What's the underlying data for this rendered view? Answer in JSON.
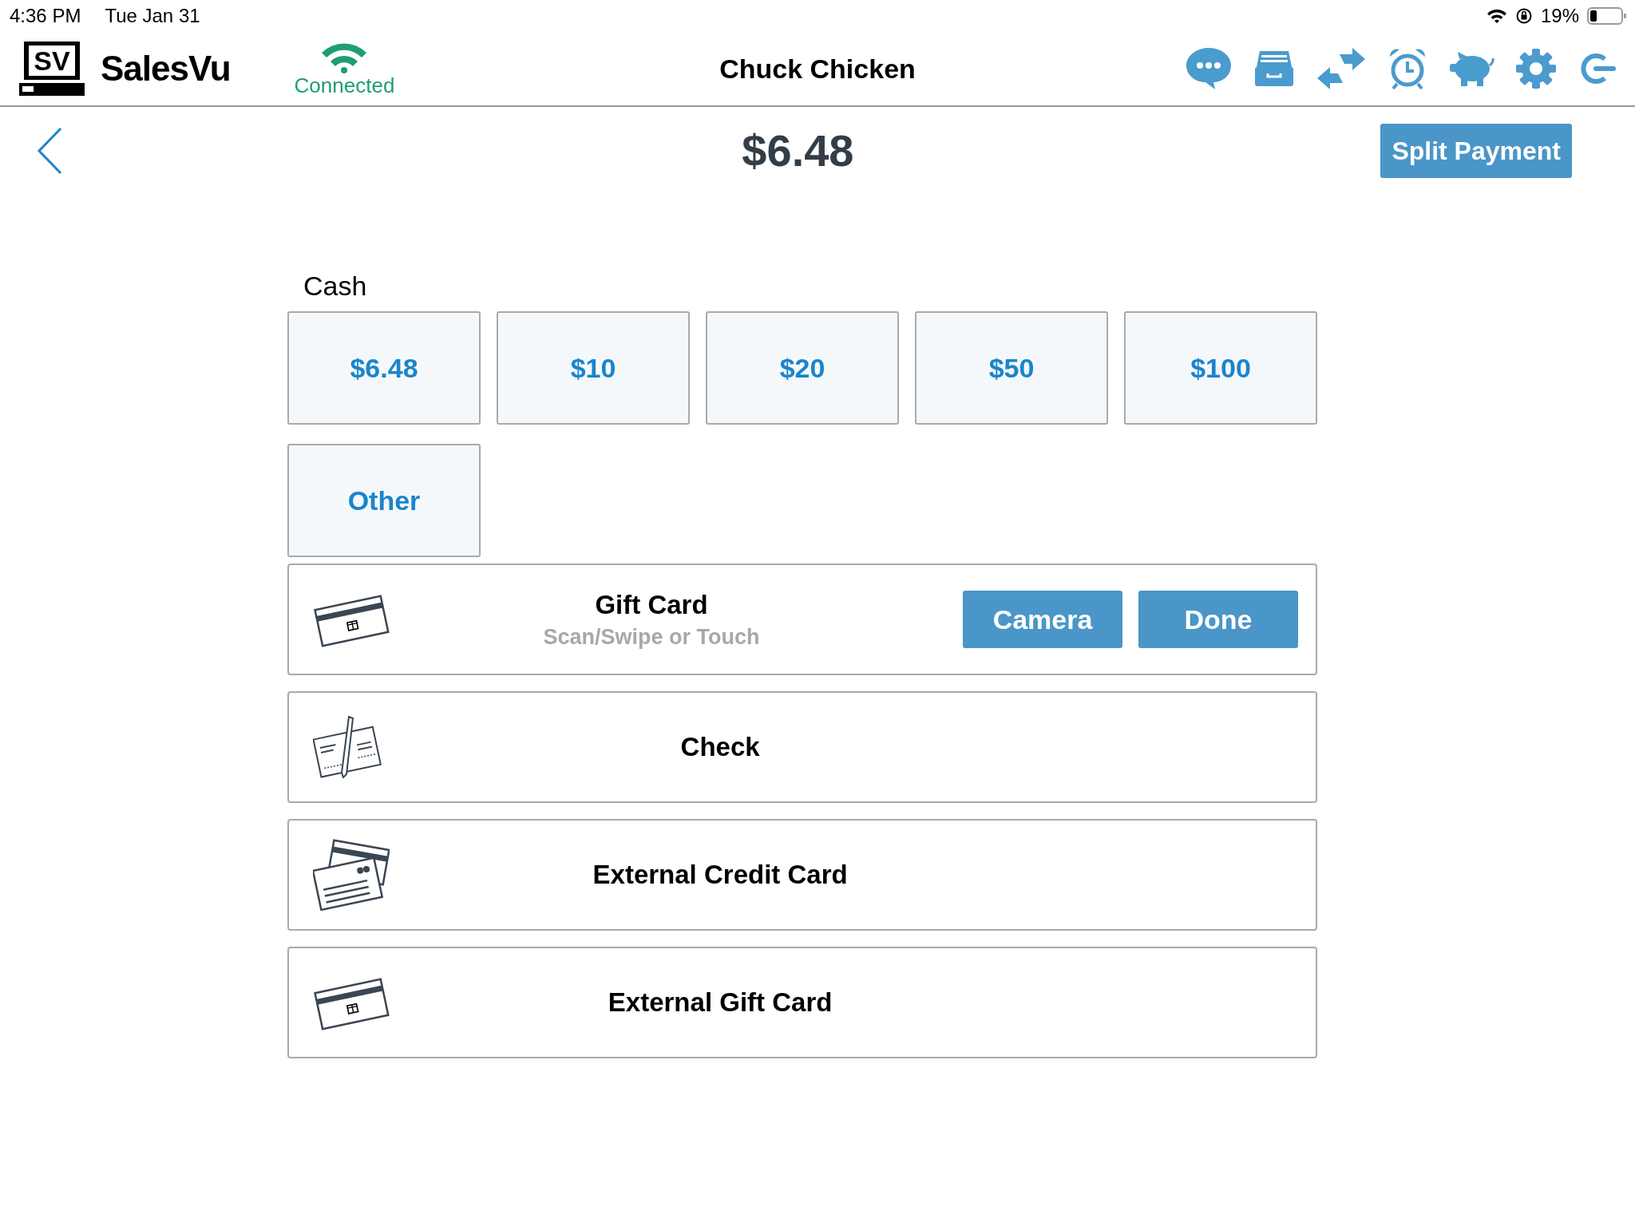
{
  "status_bar": {
    "time": "4:36 PM",
    "date": "Tue Jan 31",
    "battery": "19%"
  },
  "header": {
    "logo_text": "SV",
    "brand": "SalesVu",
    "connection": "Connected",
    "title": "Chuck Chicken"
  },
  "amount": "$6.48",
  "split_button": "Split Payment",
  "cash": {
    "label": "Cash",
    "amounts": [
      "$6.48",
      "$10",
      "$20",
      "$50",
      "$100",
      "Other"
    ]
  },
  "methods": [
    {
      "kind": "gift_card_entry",
      "label": "Gift Card",
      "placeholder": "Scan/Swipe or Touch",
      "buttons": [
        "Camera",
        "Done"
      ]
    },
    {
      "kind": "check",
      "label": "Check"
    },
    {
      "kind": "credit_card",
      "label": "External Credit Card"
    },
    {
      "kind": "gift_card",
      "label": "External Gift Card"
    }
  ]
}
